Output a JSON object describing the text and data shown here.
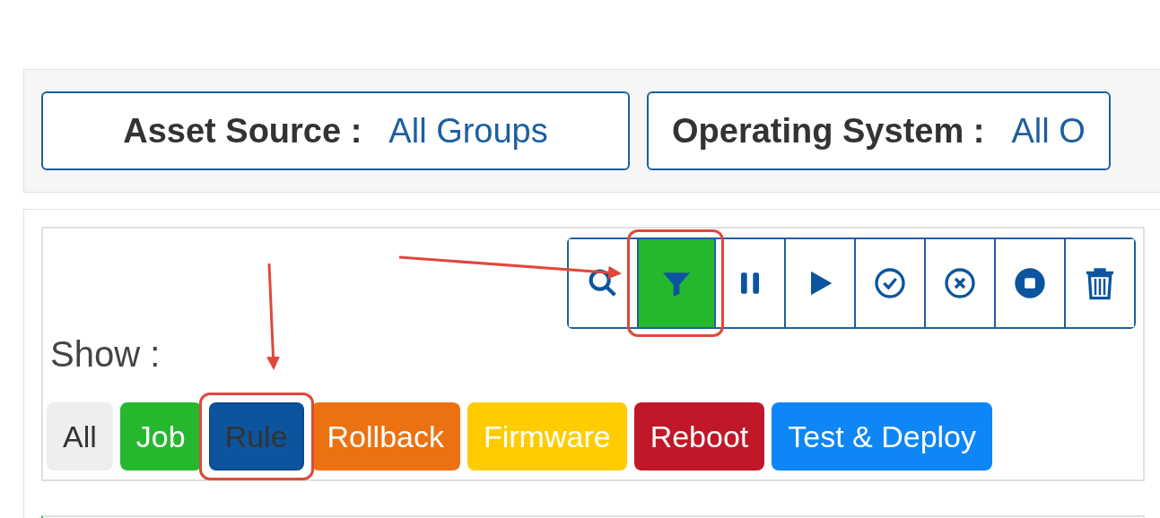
{
  "filters": [
    {
      "label": "Asset Source :",
      "value": "All Groups"
    },
    {
      "label": "Operating System :",
      "value": "All O"
    }
  ],
  "toolbar": [
    {
      "kind": "search",
      "active": false,
      "highlighted": false
    },
    {
      "kind": "filter",
      "active": true,
      "highlighted": true
    },
    {
      "kind": "pause",
      "active": false,
      "highlighted": false
    },
    {
      "kind": "play",
      "active": false,
      "highlighted": false
    },
    {
      "kind": "check",
      "active": false,
      "highlighted": false
    },
    {
      "kind": "cancel",
      "active": false,
      "highlighted": false
    },
    {
      "kind": "stop",
      "active": false,
      "highlighted": false
    },
    {
      "kind": "trash",
      "active": false,
      "highlighted": false
    }
  ],
  "show_label": "Show :",
  "chips": [
    {
      "label": "All",
      "color": "#eeeeee",
      "selected": false,
      "highlighted": false
    },
    {
      "label": "Job",
      "color": "#25b82f",
      "selected": false,
      "highlighted": false
    },
    {
      "label": "Rule",
      "color": "#0c559e",
      "selected": true,
      "highlighted": true
    },
    {
      "label": "Rollback",
      "color": "#ec7211",
      "selected": false,
      "highlighted": false
    },
    {
      "label": "Firmware",
      "color": "#ffcc00",
      "selected": false,
      "highlighted": false
    },
    {
      "label": "Reboot",
      "color": "#c01828",
      "selected": false,
      "highlighted": false
    },
    {
      "label": "Test & Deploy",
      "color": "#0e86f5",
      "selected": false,
      "highlighted": false
    }
  ]
}
